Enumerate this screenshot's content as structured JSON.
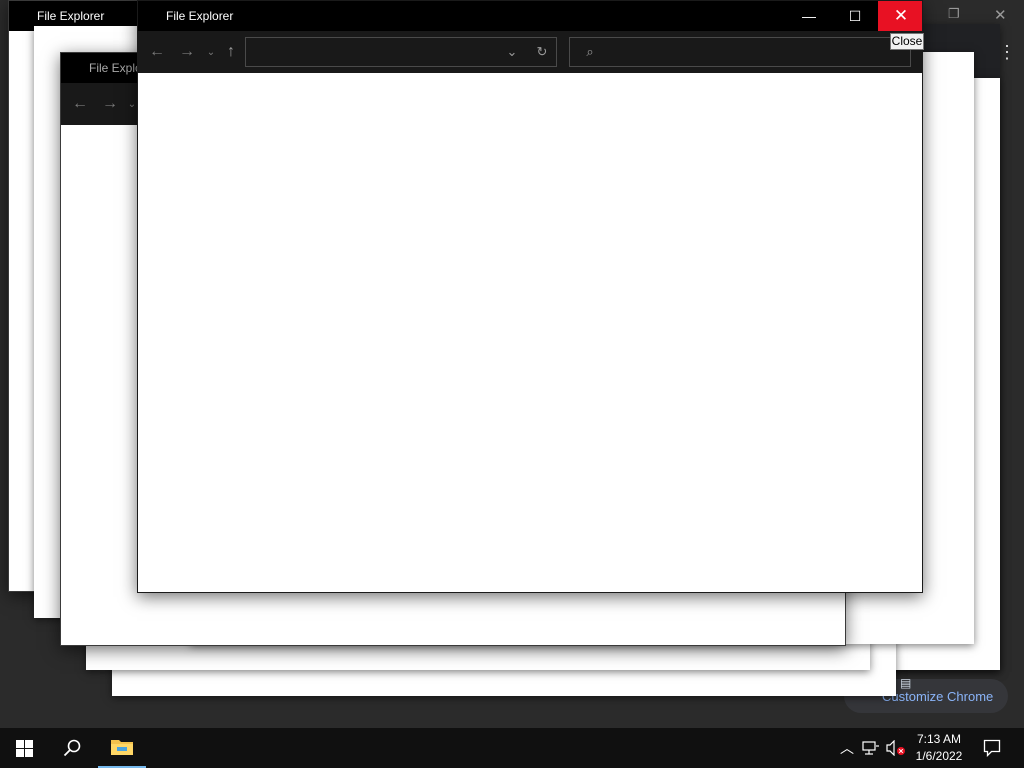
{
  "windows": {
    "back_far": {
      "title": "File Explorer"
    },
    "back_mid": {
      "title": "File Explo"
    },
    "front": {
      "title": "File Explorer"
    }
  },
  "window_controls": {
    "minimize_glyph": "—",
    "maximize_glyph": "☐",
    "close_glyph": "✕",
    "close_tooltip": "Close"
  },
  "background_chrome": {
    "customize_label": "Customize Chrome",
    "menu_glyph": "⋮"
  },
  "front_toolbar": {
    "address_value": "",
    "search_placeholder": ""
  },
  "taskbar": {
    "time": "7:13 AM",
    "date": "1/6/2022",
    "pinned": [
      "file-explorer"
    ]
  },
  "colors": {
    "close_red": "#e81123",
    "titlebar": "#000000",
    "toolbar": "#191919",
    "taskbar": "#101010",
    "accent_link": "#8ab4f8"
  }
}
